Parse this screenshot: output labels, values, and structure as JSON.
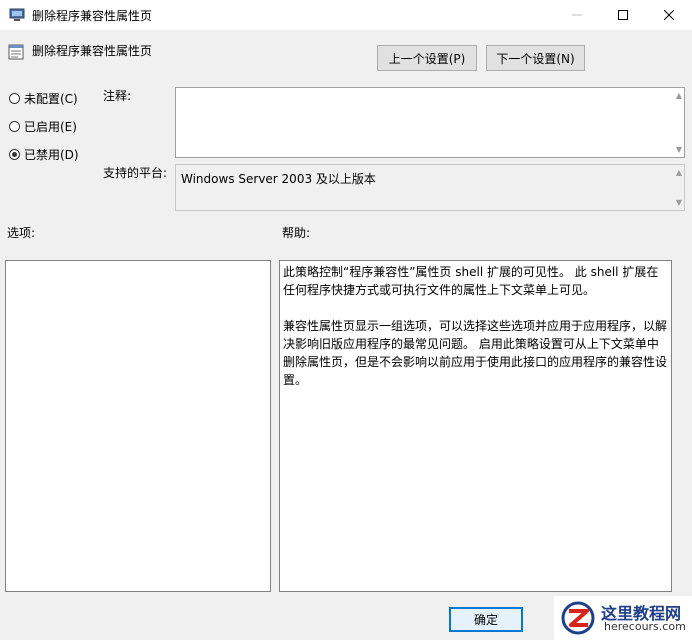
{
  "window": {
    "title": "删除程序兼容性属性页",
    "minimize_icon": "minimize-icon",
    "maximize_icon": "maximize-icon",
    "close_icon": "close-icon"
  },
  "header": {
    "policy_name": "删除程序兼容性属性页",
    "prev_label": "上一个设置(P)",
    "next_label": "下一个设置(N)"
  },
  "state": {
    "options": [
      {
        "label": "未配置(C)",
        "checked": false
      },
      {
        "label": "已启用(E)",
        "checked": false
      },
      {
        "label": "已禁用(D)",
        "checked": true
      }
    ]
  },
  "comment": {
    "label": "注释:",
    "value": ""
  },
  "platform": {
    "label": "支持的平台:",
    "value": "Windows Server 2003 及以上版本"
  },
  "options_panel": {
    "label": "选项:"
  },
  "help_panel": {
    "label": "帮助:",
    "text": "此策略控制“程序兼容性”属性页 shell 扩展的可见性。 此 shell 扩展在任何程序快捷方式或可执行文件的属性上下文菜单上可见。\n\n兼容性属性页显示一组选项，可以选择这些选项并应用于应用程序，以解决影响旧版应用程序的最常见问题。 启用此策略设置可从上下文菜单中删除属性页，但是不会影响以前应用于使用此接口的应用程序的兼容性设置。"
  },
  "footer": {
    "ok_label": "确定"
  },
  "watermark": {
    "cn": "这里教程网",
    "en": "herecours.com"
  },
  "colors": {
    "accent": "#0078d7",
    "watermark_red": "#d9241b",
    "watermark_blue": "#1e3f8c"
  }
}
